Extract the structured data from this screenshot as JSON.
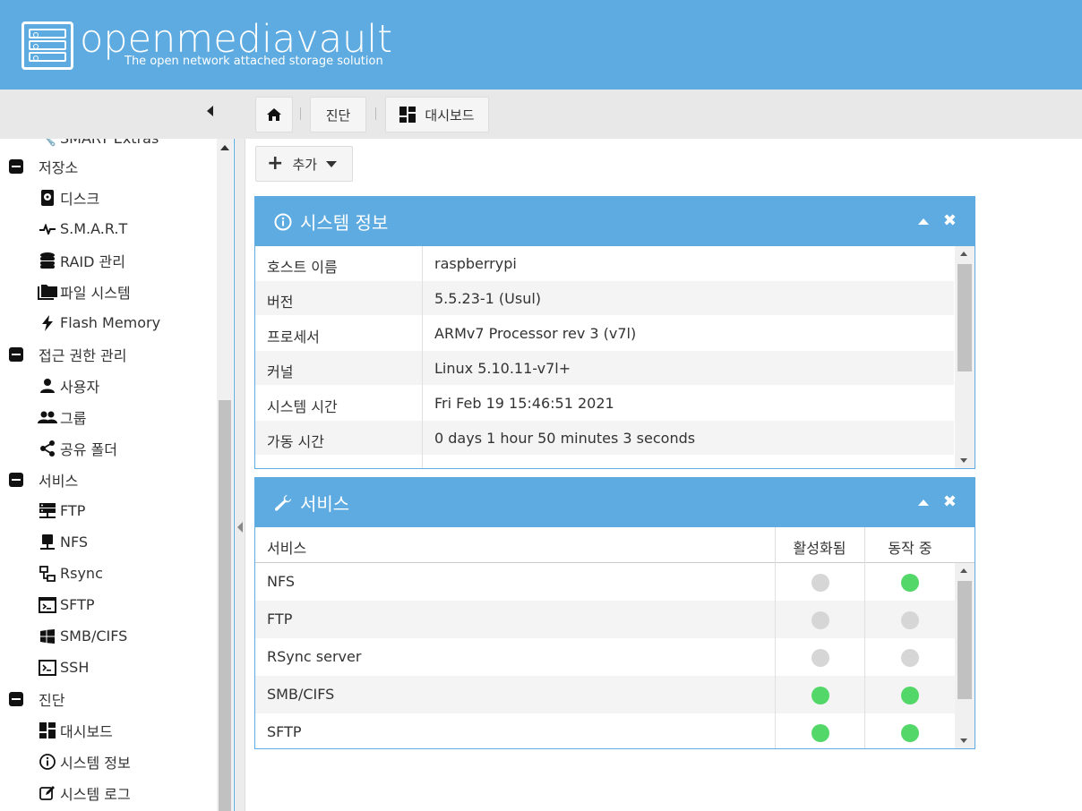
{
  "brand": {
    "name": "openmediavault",
    "tagline": "The open network attached storage solution"
  },
  "breadcrumbs": {
    "diagnostics": "진단",
    "dashboard": "대시보드"
  },
  "sidebar": {
    "partial_item": "SMART Extras",
    "storage": {
      "label": "저장소",
      "items": [
        "디스크",
        "S.M.A.R.T",
        "RAID 관리",
        "파일 시스템",
        "Flash Memory"
      ]
    },
    "access": {
      "label": "접근 권한 관리",
      "items": [
        "사용자",
        "그룹",
        "공유 폴더"
      ]
    },
    "services": {
      "label": "서비스",
      "items": [
        "FTP",
        "NFS",
        "Rsync",
        "SFTP",
        "SMB/CIFS",
        "SSH"
      ]
    },
    "diagnostics": {
      "label": "진단",
      "items": [
        "대시보드",
        "시스템 정보",
        "시스템 로그"
      ]
    }
  },
  "toolbar": {
    "add_label": "추가"
  },
  "sysinfo": {
    "title": "시스템 정보",
    "rows": [
      {
        "key": "호스트 이름",
        "value": "raspberrypi"
      },
      {
        "key": "버전",
        "value": "5.5.23-1 (Usul)"
      },
      {
        "key": "프로세서",
        "value": "ARMv7 Processor rev 3 (v7l)"
      },
      {
        "key": "커널",
        "value": "Linux 5.10.11-v7l+"
      },
      {
        "key": "시스템 시간",
        "value": "Fri Feb 19 15:46:51 2021"
      },
      {
        "key": "가동 시간",
        "value": "0 days 1 hour 50 minutes 3 seconds"
      }
    ]
  },
  "services_panel": {
    "title": "서비스",
    "columns": [
      "서비스",
      "활성화됨",
      "동작 중"
    ],
    "rows": [
      {
        "name": "NFS",
        "enabled": false,
        "running": true
      },
      {
        "name": "FTP",
        "enabled": false,
        "running": false
      },
      {
        "name": "RSync server",
        "enabled": false,
        "running": false
      },
      {
        "name": "SMB/CIFS",
        "enabled": true,
        "running": true
      },
      {
        "name": "SFTP",
        "enabled": true,
        "running": true
      }
    ]
  },
  "colors": {
    "accent": "#5dabe0",
    "status_on": "#53d769",
    "status_off": "#d6d6d6"
  }
}
